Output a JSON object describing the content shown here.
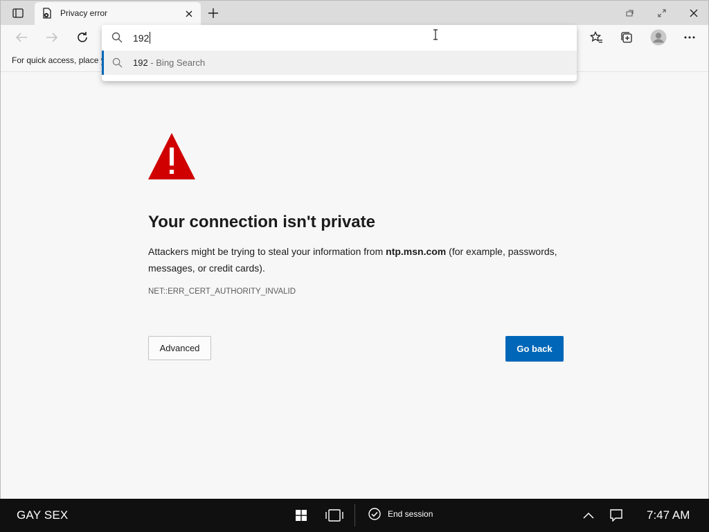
{
  "browser": {
    "tab": {
      "title": "Privacy error"
    },
    "favorites_bar": {
      "hint": "For quick access, place y"
    },
    "omnibox": {
      "query": "192",
      "suggestions": [
        {
          "text": "192",
          "source": " - Bing Search"
        }
      ]
    }
  },
  "page": {
    "headline": "Your connection isn't private",
    "description_before": "Attackers might be trying to steal your information from ",
    "domain": "ntp.msn.com",
    "description_after": " (for example, passwords, messages, or credit cards).",
    "error_code": "NET::ERR_CERT_AUTHORITY_INVALID",
    "advanced_label": "Advanced",
    "back_label": "Go back"
  },
  "taskbar": {
    "brand": "GAY SEX",
    "end_session_label": "End session",
    "clock": "7:47 AM"
  },
  "colors": {
    "accent": "#0067b8",
    "warning": "#d00000",
    "taskbar": "#101010"
  }
}
